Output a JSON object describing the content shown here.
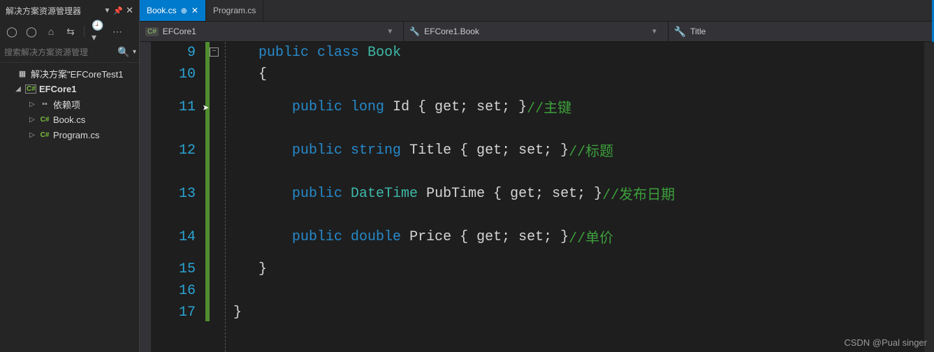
{
  "sidebar": {
    "title": "解决方案资源管理器",
    "search_placeholder": "搜索解决方案资源管理",
    "solution_label": "解决方案\"EFCoreTest1",
    "project_label": "EFCore1",
    "deps_label": "依赖项",
    "file_book": "Book.cs",
    "file_program": "Program.cs"
  },
  "tabs": {
    "active": "Book.cs",
    "inactive": "Program.cs"
  },
  "navbar": {
    "namespace": "EFCore1",
    "class": "EFCore1.Book",
    "member": "Title"
  },
  "code": {
    "line_numbers": [
      "9",
      "10",
      "11",
      "12",
      "13",
      "14",
      "15",
      "16",
      "17"
    ],
    "l9_kw1": "public",
    "l9_kw2": "class",
    "l9_type": "Book",
    "l10_brace": "{",
    "l11_kw": "public",
    "l11_type": "long",
    "l11_name": "Id",
    "l11_body": " { get; set; }",
    "l11_cmt": "//主键",
    "l12_kw": "public",
    "l12_type": "string",
    "l12_name": "Title",
    "l12_body": " { get; set; }",
    "l12_cmt": "//标题",
    "l13_kw": "public",
    "l13_type": "DateTime",
    "l13_name": "PubTime",
    "l13_body": " { get; set; }",
    "l13_cmt": "//发布日期",
    "l14_kw": "public",
    "l14_type": "double",
    "l14_name": "Price",
    "l14_body": " { get; set; }",
    "l14_cmt": "//单价",
    "l15_brace": "}",
    "l17_brace": "}"
  },
  "watermark": "CSDN @Pual singer"
}
